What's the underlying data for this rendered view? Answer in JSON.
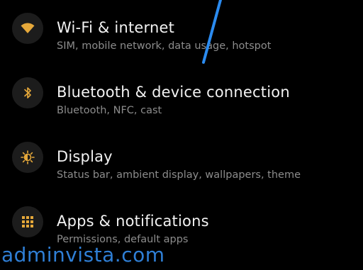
{
  "accent_color": "#e5a83a",
  "settings": {
    "items": [
      {
        "title": "Wi-Fi & internet",
        "subtitle": "SIM, mobile network, data usage, hotspot",
        "icon": "wifi-icon"
      },
      {
        "title": "Bluetooth & device connection",
        "subtitle": "Bluetooth, NFC, cast",
        "icon": "bluetooth-icon"
      },
      {
        "title": "Display",
        "subtitle": "Status bar, ambient display, wallpapers, theme",
        "icon": "brightness-icon"
      },
      {
        "title": "Apps & notifications",
        "subtitle": "Permissions, default apps",
        "icon": "apps-grid-icon"
      }
    ]
  },
  "watermark": {
    "text": "adminvista.com"
  }
}
